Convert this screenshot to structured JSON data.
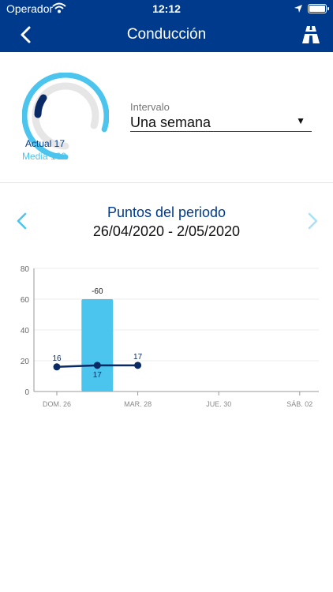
{
  "status_bar": {
    "carrier": "Operador",
    "time": "12:12"
  },
  "nav": {
    "title": "Conducción"
  },
  "gauge": {
    "actual_label": "Actual 17",
    "media_label": "Media 100",
    "actual_value": 17,
    "media_value": 100
  },
  "interval": {
    "label": "Intervalo",
    "value": "Una semana"
  },
  "period": {
    "title": "Puntos del periodo",
    "range": "26/04/2020 - 2/05/2020"
  },
  "colors": {
    "brand": "#003a8c",
    "accent": "#4bc4ee",
    "track": "#e6e6e6",
    "bar": "#4bc4ee",
    "line": "#0a2a66"
  },
  "icons": {
    "back": "chevron-left-icon",
    "road": "road-icon",
    "prev": "chevron-left-icon",
    "next": "chevron-right-icon"
  },
  "chart_data": {
    "type": "bar",
    "ylim": [
      0,
      80
    ],
    "y_ticks": [
      "0",
      "20",
      "40",
      "60",
      "80"
    ],
    "x_ticks": [
      "DOM. 26",
      "MAR. 28",
      "JUE. 30",
      "SÁB. 02"
    ],
    "x_tick_positions": [
      0,
      2,
      4,
      6
    ],
    "bars": [
      {
        "x": 1,
        "value": 60,
        "label": "-60"
      }
    ],
    "line": {
      "points": [
        {
          "x": 0,
          "y": 16
        },
        {
          "x": 1,
          "y": 17
        },
        {
          "x": 2,
          "y": 17
        }
      ],
      "labels": [
        "16",
        "17",
        "17"
      ]
    },
    "grid": true
  }
}
